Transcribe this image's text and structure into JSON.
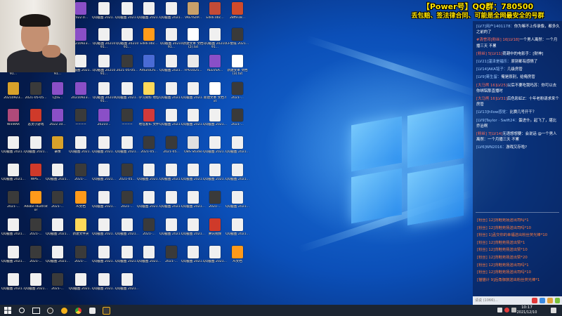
{
  "stream_banner": {
    "line1": "【Power号】QQ群：780500",
    "line2": "丢包赔、签法律合同、可能是全网最安全的号群"
  },
  "chat": {
    "messages": [
      {
        "badge": "",
        "name": "[LV7]用户1401178：",
        "text": "你为嘛不上传录像，都多久之前的了"
      },
      {
        "badge": "#清誉邓[粉丝] 16[LV18]",
        "name": "",
        "text": "一个男人离然：一个月播三天 不累"
      },
      {
        "badge": "[粉丝] 5[LV11]",
        "name": "",
        "text": "荷葫中的电影手：[财神]"
      },
      {
        "badge": "",
        "name": "[LV21]温泽是福乐：",
        "text": "原别都有感情了"
      },
      {
        "badge": "",
        "name": "[LV14]AKA铭子：",
        "text": "几级房管"
      },
      {
        "badge": "",
        "name": "[LV9]蒋生留：",
        "text": "俺是原别，给俺房管"
      },
      {
        "badge": "[大马熊 16]LV25]",
        "name": "",
        "text": "以后不要吃我吗苏：你可以去你绑铝那直播时"
      },
      {
        "badge": "[大马熊 16]LV31]",
        "name": "",
        "text": "后色彩虹Z：十年老粉请求来个房管"
      },
      {
        "badge": "",
        "name": "[LV13]hllow感觉：",
        "text": "比赛几号开干？"
      },
      {
        "badge": "",
        "name": "[LV9]Taylor · Swift24：",
        "text": "蛋进什。起飞了，堪比乔治啊"
      },
      {
        "badge": "[粉丝] 7[LV14]",
        "name": "",
        "text": "无语想想要：会说话 @一个男人离然：一个月播三天 不累"
      },
      {
        "badge": "",
        "name": "[LV6]WN2016：",
        "text": "游戏又存啦?"
      }
    ],
    "gifts": [
      "[粉丝] 12]背鞋苑扬送出司吗*1",
      "[粉丝] 12]背鞋苑扬送出司吗*10",
      "[粉丝] 1]孟交你的幸福送出粉丝荧光棒*10",
      "[粉丝] 12]背鞋苑扬送出赞*1",
      "[粉丝] 12]背鞋苑扬送出赞*10",
      "[粉丝] 12]背鞋苑扬送出赞*20",
      "[粉丝] 12]背鞋苑扬送出司吗*1",
      "[粉丝] 12]背鞋苑扬送出司吗*10",
      "[猫猫计 9]后角御旅送出粉丝荧光棒*1"
    ],
    "input_placeholder": "请说 (1066)..."
  },
  "taskbar": {
    "time": "10:17",
    "date": "2021/12/10"
  },
  "icons": [
    {
      "label": "2021-05-05 1号_0_1",
      "color": "#3a3a3a"
    },
    {
      "label": "1.1",
      "color": "#e9e9e9"
    },
    {
      "label": "QQ截图 20210912...",
      "color": "#f2f2f2"
    },
    {
      "label": "2022.0...",
      "color": "#8a4fc7"
    },
    {
      "label": "QQ截图 2021...",
      "color": "#f0f0f0"
    },
    {
      "label": "QQ截图 2021...",
      "color": "#f0f0f0"
    },
    {
      "label": "QQ截图 2021...",
      "color": "#f0f0f0"
    },
    {
      "label": "QQ截图 2021...",
      "color": "#f0f0f0"
    },
    {
      "label": "VKEYS/IP...",
      "color": "#c8a06a"
    },
    {
      "label": "Eds6.0bc...",
      "color": "#c44b37"
    },
    {
      "label": "28ffe18...",
      "color": "#d04a2a"
    },
    {
      "label": "9c86a6b...",
      "color": "#6b7b9a"
    },
    {
      "label": "PNG1b...",
      "color": "#9a6b4a"
    },
    {
      "label": "UNCAN...",
      "color": "#e9e9e9"
    },
    {
      "label": "20210923...",
      "color": "#8a4fc7"
    },
    {
      "label": "QQ截图 2021091...",
      "color": "#f0f0f0"
    },
    {
      "label": "QQ截图 2021091...",
      "color": "#f0f0f0"
    },
    {
      "label": "Eds6.0bc...",
      "color": "#ff9b1a"
    },
    {
      "label": "QQ截图 2021091...",
      "color": "#f0f0f0"
    },
    {
      "label": "新建文本 文档(2).txt",
      "color": "#ffffff"
    },
    {
      "label": "QQ截图 2021091...",
      "color": "#f0f0f0"
    },
    {
      "label": "CF壁纸 2021...",
      "color": "#3a3a3a"
    },
    {
      "label": "QQ截图 2021091...",
      "color": "#f0f0f0"
    },
    {
      "label": "SeS.IDE...",
      "color": "#8a4fc7"
    },
    {
      "label": "QQ截图 2021091...",
      "color": "#f0f0f0"
    },
    {
      "label": "QQ截图 2021...",
      "color": "#f0f0f0"
    },
    {
      "label": "QQ截图 2021091...",
      "color": "#f0f0f0"
    },
    {
      "label": "2021-05-05...",
      "color": "#3a3a3a"
    },
    {
      "label": "AmuroChi...",
      "color": "#4a6bd4"
    },
    {
      "label": "QQ截图 2021...",
      "color": "#f0f0f0"
    },
    {
      "label": "FPO1025...",
      "color": "#e9e9e9"
    },
    {
      "label": "AEEVSA...",
      "color": "#8a4fc7"
    },
    {
      "label": "新建文本 文档(3).txt",
      "color": "#ffffff"
    },
    {
      "label": "20210923...",
      "color": "#d8a12a"
    },
    {
      "label": "2021-05-05...",
      "color": "#3a3a3a"
    },
    {
      "label": "CJ5S...",
      "color": "#8a4fc7"
    },
    {
      "label": "20210923...",
      "color": "#8a4fc7"
    },
    {
      "label": "QQ截图 2021091...",
      "color": "#f0f0f0"
    },
    {
      "label": "QQ截图 2021...",
      "color": "#f0f0f0"
    },
    {
      "label": "学习资料 地址",
      "color": "#ffd95a"
    },
    {
      "label": "QQ截图 2021...",
      "color": "#f0f0f0"
    },
    {
      "label": "QQ截图 2021...",
      "color": "#f0f0f0"
    },
    {
      "label": "新建文本 文档.txt",
      "color": "#ffffff"
    },
    {
      "label": "2021-...",
      "color": "#3a3a3a"
    },
    {
      "label": "WinRAR",
      "color": "#b04a7a"
    },
    {
      "label": "恶灵小游戏",
      "color": "#cf3a2a"
    },
    {
      "label": "2022.10...",
      "color": "#8a4fc7"
    },
    {
      "label": "~~~~",
      "color": "#3a3a3a"
    },
    {
      "label": "20210...",
      "color": "#8a4fc7"
    },
    {
      "label": "~~~~",
      "color": "#3a3a3a"
    },
    {
      "label": "地址发布 文件",
      "color": "#d23a3a"
    },
    {
      "label": "QQ截图 2021...",
      "color": "#f0f0f0"
    },
    {
      "label": "QQ截图 2021...",
      "color": "#f0f0f0"
    },
    {
      "label": "QQ截图 2021...",
      "color": "#f0f0f0"
    },
    {
      "label": "2021-...",
      "color": "#3a3a3a"
    },
    {
      "label": "QQ截图 2021...",
      "color": "#f0f0f0"
    },
    {
      "label": "QQ截图 2021...",
      "color": "#f0f0f0"
    },
    {
      "label": "录像",
      "color": "#d8a12a"
    },
    {
      "label": "QQ截图 2021...",
      "color": "#f0f0f0"
    },
    {
      "label": "QQ截图 2021...",
      "color": "#f0f0f0"
    },
    {
      "label": "QQ截图 2021...",
      "color": "#f0f0f0"
    },
    {
      "label": "2021-05...",
      "color": "#3a3a3a"
    },
    {
      "label": "2021-05...",
      "color": "#3a3a3a"
    },
    {
      "label": "OBS Studio",
      "color": "#e0e0e0"
    },
    {
      "label": "QQ截图 2021...",
      "color": "#f0f0f0"
    },
    {
      "label": "QQ截图 2021...",
      "color": "#f0f0f0"
    },
    {
      "label": "QQ截图 2021...",
      "color": "#f0f0f0"
    },
    {
      "label": "WPS...",
      "color": "#cf3a2a"
    },
    {
      "label": "QQ截图 2021...",
      "color": "#f0f0f0"
    },
    {
      "label": "2021-...",
      "color": "#3a3a3a"
    },
    {
      "label": "QQ截图 2021...",
      "color": "#f0f0f0"
    },
    {
      "label": "2021-05...",
      "color": "#3a3a3a"
    },
    {
      "label": "QQ截图 2021...",
      "color": "#f0f0f0"
    },
    {
      "label": "QQ截图 2021...",
      "color": "#f0f0f0"
    },
    {
      "label": "QQ截图 2021...",
      "color": "#f0f0f0"
    },
    {
      "label": "QQ截图 2021...",
      "color": "#f0f0f0"
    },
    {
      "label": "QQ截图 2021...",
      "color": "#f0f0f0"
    },
    {
      "label": "2021-...",
      "color": "#3a3a3a"
    },
    {
      "label": "Adobe Illustrator",
      "color": "#ff9a1a"
    },
    {
      "label": "2021-...",
      "color": "#3a3a3a"
    },
    {
      "label": "Ai文档",
      "color": "#ff9a1a"
    },
    {
      "label": "QQ截图 2021...",
      "color": "#f0f0f0"
    },
    {
      "label": "2021-...",
      "color": "#3a3a3a"
    },
    {
      "label": "QQ截图 2021...",
      "color": "#f0f0f0"
    },
    {
      "label": "QQ截图 2021...",
      "color": "#f0f0f0"
    },
    {
      "label": "QQ截图 2021...",
      "color": "#f0f0f0"
    },
    {
      "label": "2021-...",
      "color": "#3a3a3a"
    },
    {
      "label": "QQ截图 2021...",
      "color": "#f0f0f0"
    },
    {
      "label": "QQ截图 2021...",
      "color": "#f0f0f0"
    },
    {
      "label": "2021-...",
      "color": "#3a3a3a"
    },
    {
      "label": "QQ截图 2021...",
      "color": "#f0f0f0"
    },
    {
      "label": "新建文件夹",
      "color": "#ffd95a"
    },
    {
      "label": "QQ截图 2021...",
      "color": "#f0f0f0"
    },
    {
      "label": "QQ截图 2021...",
      "color": "#f0f0f0"
    },
    {
      "label": "2021-...",
      "color": "#3a3a3a"
    },
    {
      "label": "QQ截图 2021...",
      "color": "#f0f0f0"
    },
    {
      "label": "QQ截图 2021...",
      "color": "#f0f0f0"
    },
    {
      "label": "腾讯视频",
      "color": "#cf3a2a"
    },
    {
      "label": "QQ截图 2021...",
      "color": "#f0f0f0"
    },
    {
      "label": "QQ截图 2021...",
      "color": "#f0f0f0"
    },
    {
      "label": "2021-...",
      "color": "#3a3a3a"
    },
    {
      "label": "QQ截图 2021...",
      "color": "#f0f0f0"
    },
    {
      "label": "2021-...",
      "color": "#3a3a3a"
    },
    {
      "label": "QQ截图 2021...",
      "color": "#f0f0f0"
    },
    {
      "label": "QQ截图 2021...",
      "color": "#f0f0f0"
    },
    {
      "label": "QQ截图 2021...",
      "color": "#f0f0f0"
    },
    {
      "label": "2021-...",
      "color": "#3a3a3a"
    },
    {
      "label": "QQ截图 2021...",
      "color": "#f0f0f0"
    },
    {
      "label": "QQ截图 2021...",
      "color": "#f0f0f0"
    },
    {
      "label": "Ai文档",
      "color": "#ff9a1a"
    },
    {
      "label": "QQ截图 2021...",
      "color": "#f0f0f0"
    },
    {
      "label": "QQ截图 2021...",
      "color": "#f0f0f0"
    },
    {
      "label": "2021-...",
      "color": "#3a3a3a"
    },
    {
      "label": "QQ截图 2021...",
      "color": "#f0f0f0"
    },
    {
      "label": "QQ截图 2021...",
      "color": "#f0f0f0"
    },
    {
      "label": "QQ截图 2021...",
      "color": "#f0f0f0"
    }
  ]
}
